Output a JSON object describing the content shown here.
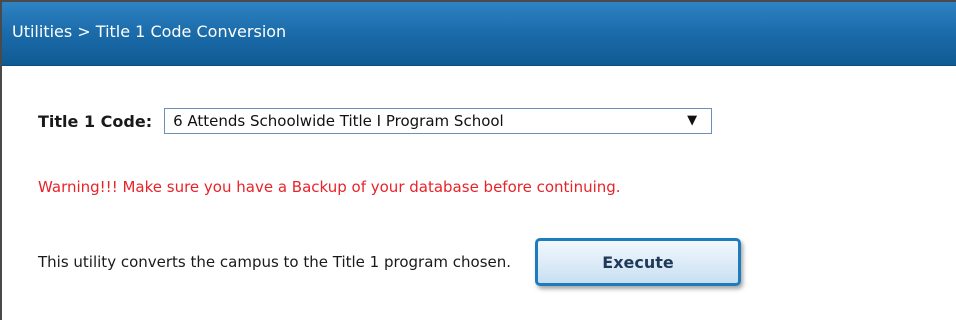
{
  "header": {
    "title": "Utilities > Title 1 Code Conversion",
    "background": "#1c6dac"
  },
  "form": {
    "title1_label": "Title 1 Code:",
    "title1_selected": "6 Attends Schoolwide Title I Program School",
    "warning": "Warning!!! Make sure you have a Backup of your database before continuing.",
    "warning_color": "#e8232a",
    "description": "This utility converts the campus to the Title 1 program chosen.",
    "execute_label": "Execute"
  },
  "icons": {
    "dropdown_arrow": "chevron-down-icon",
    "dropdown_glyph": "▼"
  }
}
